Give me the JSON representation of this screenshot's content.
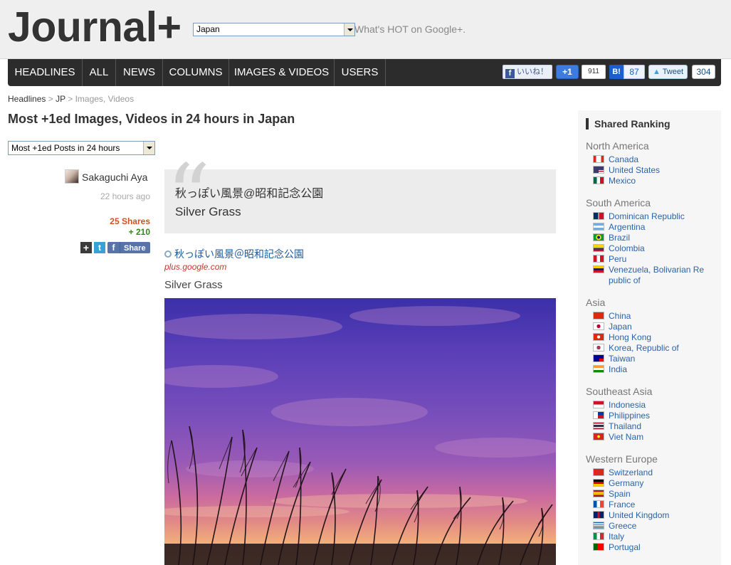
{
  "header": {
    "logo": "Journal+",
    "country_selected": "Japan",
    "tagline": "What's HOT on Google+."
  },
  "nav": {
    "tabs": [
      "HEADLINES",
      "ALL",
      "NEWS",
      "COLUMNS",
      "IMAGES & VIDEOS",
      "USERS"
    ]
  },
  "social": {
    "like_label": "いいね！",
    "plus_label": "+1",
    "plus_count": "911",
    "hatena_label": "B!",
    "hatena_count": "87",
    "tweet_label": "Tweet",
    "tweet_count": "304"
  },
  "breadcrumb": {
    "home": "Headlines",
    "sep": ">",
    "country": "JP",
    "current": "Images, Videos"
  },
  "page": {
    "title": "Most +1ed Images, Videos in 24 hours in Japan",
    "sort_selected": "Most +1ed Posts in 24 hours"
  },
  "post": {
    "author": "Sakaguchi Aya",
    "time_ago": "22 hours ago",
    "shares": "25 Shares",
    "plus_ones": "+ 210",
    "share_button": "Share",
    "quote_line1": "秋っぽい風景@昭和記念公園",
    "quote_line2": "Silver Grass",
    "link_text": "秋っぽい風景＠昭和記念公園",
    "domain": "plus.google.com",
    "caption": "Silver Grass"
  },
  "sidebar": {
    "title": "Shared Ranking",
    "regions": [
      {
        "name": "North America",
        "countries": [
          "Canada",
          "United States",
          "Mexico"
        ]
      },
      {
        "name": "South America",
        "countries": [
          "Dominican Republic",
          "Argentina",
          "Brazil",
          "Colombia",
          "Peru",
          "Venezuela, Bolivarian Re public of"
        ]
      },
      {
        "name": "Asia",
        "countries": [
          "China",
          "Japan",
          "Hong Kong",
          "Korea, Republic of",
          "Taiwan",
          "India"
        ]
      },
      {
        "name": "Southeast Asia",
        "countries": [
          "Indonesia",
          "Philippines",
          "Thailand",
          "Viet Nam"
        ]
      },
      {
        "name": "Western Europe",
        "countries": [
          "Switzerland",
          "Germany",
          "Spain",
          "France",
          "United Kingdom",
          "Greece",
          "Italy",
          "Portugal"
        ]
      }
    ]
  },
  "colors": {
    "nav_bg": "#2c2c2c",
    "link_blue": "#2a63a8",
    "shares_orange": "#d24f1e",
    "plus_green": "#2f8a12"
  }
}
